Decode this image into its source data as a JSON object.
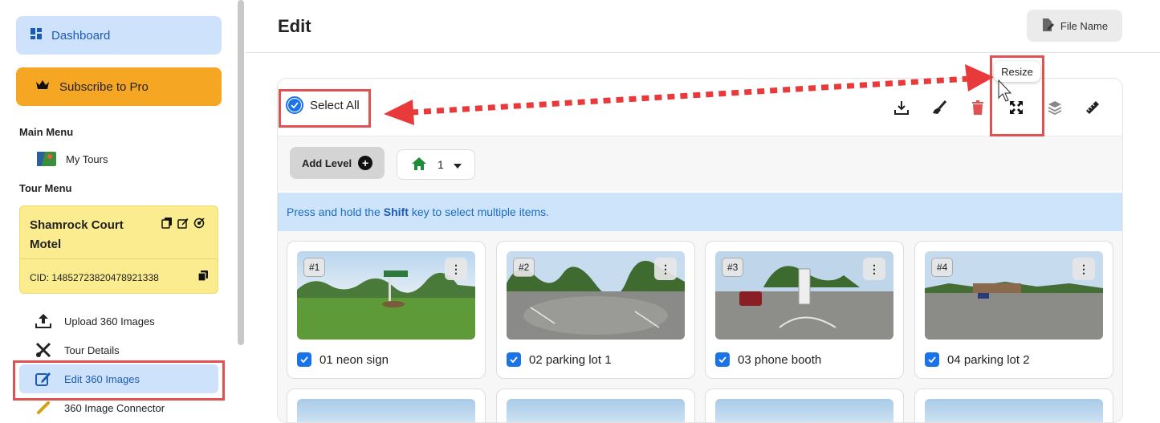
{
  "sidebar": {
    "dashboard_label": "Dashboard",
    "subscribe_label": "Subscribe to Pro",
    "main_menu_heading": "Main Menu",
    "my_tours_label": "My Tours",
    "tour_menu_heading": "Tour Menu",
    "tour": {
      "name": "Shamrock Court Motel",
      "cid": "CID: 14852723820478921338"
    },
    "items": [
      {
        "label": "Upload 360 Images",
        "icon": "upload-icon"
      },
      {
        "label": "Tour Details",
        "icon": "tools-icon"
      },
      {
        "label": "Edit 360 Images",
        "icon": "edit-icon",
        "active": true
      },
      {
        "label": "360 Image Connector",
        "icon": "link-icon"
      }
    ]
  },
  "header": {
    "title": "Edit",
    "file_name_label": "File Name"
  },
  "toolbar": {
    "select_all_label": "Select All",
    "select_all_checked": true,
    "tooltip": "Resize",
    "tools": [
      "download-icon",
      "brush-icon",
      "trash-icon",
      "resize-icon",
      "layers-icon",
      "ruler-icon"
    ]
  },
  "levels": {
    "add_level_label": "Add Level",
    "current_level": "1"
  },
  "info": {
    "before": "Press and hold the",
    "key": "Shift",
    "after": "key to select multiple items."
  },
  "images": [
    {
      "num": "#1",
      "label": "01 neon sign",
      "checked": true
    },
    {
      "num": "#2",
      "label": "02 parking lot 1",
      "checked": true
    },
    {
      "num": "#3",
      "label": "03 phone booth",
      "checked": true
    },
    {
      "num": "#4",
      "label": "04 parking lot 2",
      "checked": true
    }
  ],
  "colors": {
    "accent": "#1a73e8",
    "pro": "#f5a623",
    "tour_card": "#fbec8f",
    "highlight_box": "#e05252",
    "info_bg": "#cde4fa"
  }
}
